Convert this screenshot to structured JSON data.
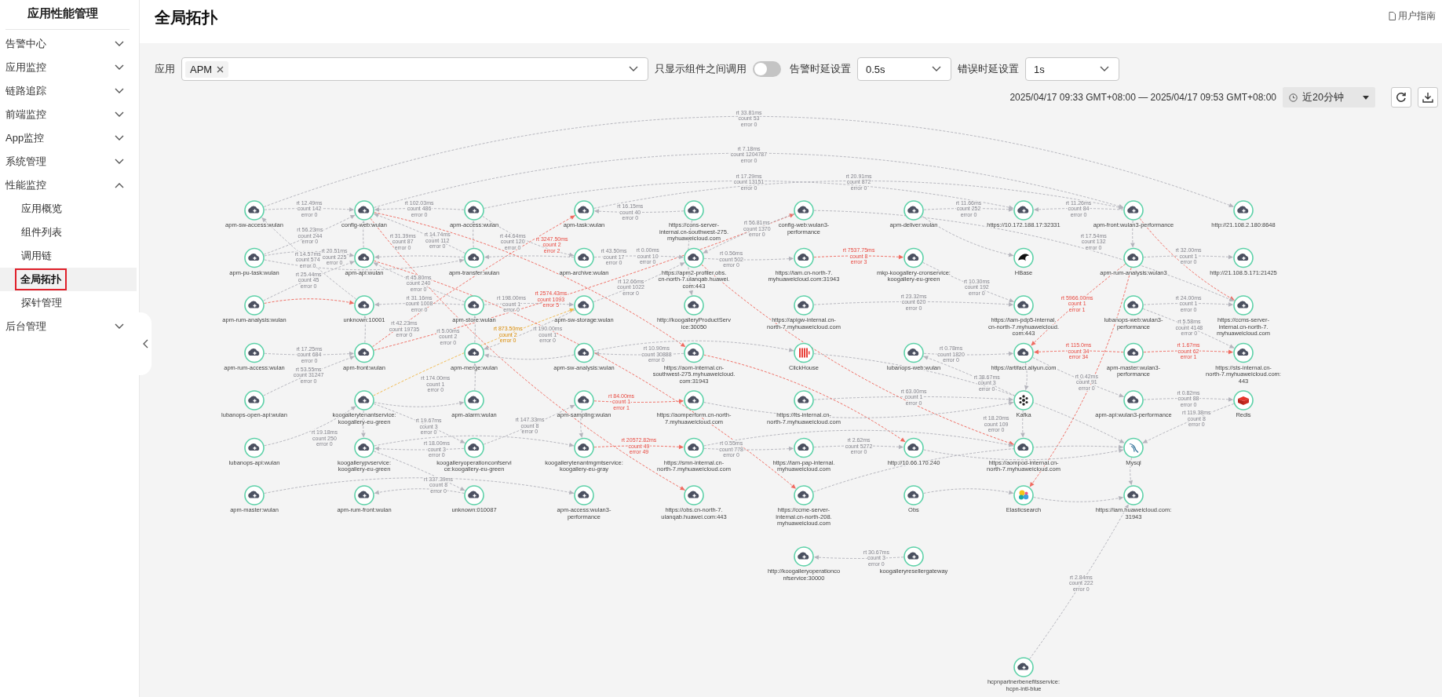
{
  "sidebar": {
    "title": "应用性能管理",
    "items": [
      {
        "label": "告警中心",
        "expanded": false
      },
      {
        "label": "应用监控",
        "expanded": false
      },
      {
        "label": "链路追踪",
        "expanded": false
      },
      {
        "label": "前端监控",
        "expanded": false
      },
      {
        "label": "App监控",
        "expanded": false
      },
      {
        "label": "系统管理",
        "expanded": false
      },
      {
        "label": "性能监控",
        "expanded": true,
        "children": [
          {
            "label": "应用概览",
            "selected": false
          },
          {
            "label": "组件列表",
            "selected": false
          },
          {
            "label": "调用链",
            "selected": false
          },
          {
            "label": "全局拓扑",
            "selected": true
          },
          {
            "label": "探针管理",
            "selected": false
          }
        ]
      },
      {
        "label": "后台管理",
        "expanded": false
      }
    ]
  },
  "header": {
    "title": "全局拓扑",
    "help_link": "用户指南"
  },
  "filters": {
    "app_label": "应用",
    "app_tags": [
      "APM"
    ],
    "toggle_label": "只显示组件之间调用",
    "toggle_on": false,
    "alarm_label": "告警时延设置",
    "alarm_value": "0.5s",
    "error_label": "错误时延设置",
    "error_value": "1s"
  },
  "time_range": {
    "text": "2025/04/17 09:33 GMT+08:00 — 2025/04/17 09:53 GMT+08:00",
    "preset": "近20分钟"
  },
  "topology": {
    "nodes": [
      {
        "label": "apm-sw-access:wulan",
        "kind": "service"
      },
      {
        "label": "config-web:wulan",
        "kind": "service"
      },
      {
        "label": "apm-access:wulan",
        "kind": "service"
      },
      {
        "label": "apm-task:wulan",
        "kind": "service"
      },
      {
        "label": "https://cons-server-internal.cn-southwest-275.myhuaweicloud.com",
        "kind": "service"
      },
      {
        "label": "config-web:wulan3-performance",
        "kind": "service"
      },
      {
        "label": "apm-deliver:wulan",
        "kind": "service"
      },
      {
        "label": "https://10.172.188.17:32331",
        "kind": "service"
      },
      {
        "label": "apm-front:wulan3-performance",
        "kind": "service"
      },
      {
        "label": "http://21.108.2.180:8648",
        "kind": "service"
      },
      {
        "label": "apm-pu-task:wulan",
        "kind": "service"
      },
      {
        "label": "apm-api:wulan",
        "kind": "service"
      },
      {
        "label": "apm-transfer:wulan",
        "kind": "service"
      },
      {
        "label": "apm-archive:wulan",
        "kind": "service"
      },
      {
        "label": "https://apm2-profiler.obs.cn-north-7.ulanqab.huawei.com:443",
        "kind": "service"
      },
      {
        "label": "https://iam.cn-north-7.myhuaweicloud.com:31943",
        "kind": "service"
      },
      {
        "label": "mkp-koogallery-cronservice:koogallery-eu-green",
        "kind": "service"
      },
      {
        "label": "HBase",
        "kind": "hbase"
      },
      {
        "label": "apm-rum-analysis:wulan3",
        "kind": "service"
      },
      {
        "label": "http://21.108.5.171:21425",
        "kind": "service"
      },
      {
        "label": "apm-rum-analysis:wulan",
        "kind": "service"
      },
      {
        "label": "unknown:10001",
        "kind": "service"
      },
      {
        "label": "apm-store:wulan",
        "kind": "service"
      },
      {
        "label": "apm-sw-storage:wulan",
        "kind": "service"
      },
      {
        "label": "http://koogalleryProductService:30050",
        "kind": "service"
      },
      {
        "label": "https://apigw-internal.cn-north-7.myhuaweicloud.com",
        "kind": "service"
      },
      {
        "label": "https://iam-pdp5-internal.cn-north-7.myhuaweicloud.com:443",
        "kind": "service"
      },
      {
        "label": "lubanops-web:wulan3-performance",
        "kind": "service"
      },
      {
        "label": "https://ccms-server-internal.cn-north-7.myhuaweicloud.com",
        "kind": "service"
      },
      {
        "label": "apm-rum-access:wulan",
        "kind": "service"
      },
      {
        "label": "apm-front:wulan",
        "kind": "service"
      },
      {
        "label": "apm-merge:wulan",
        "kind": "service"
      },
      {
        "label": "apm-sw-analysis:wulan",
        "kind": "service"
      },
      {
        "label": "https://aom-internal.cn-southwest-275.myhuaweicloud.com:31943",
        "kind": "service"
      },
      {
        "label": "ClickHouse",
        "kind": "clickhouse"
      },
      {
        "label": "lubanops-web:wulan",
        "kind": "service"
      },
      {
        "label": "https://artifact.aliyun.com",
        "kind": "service"
      },
      {
        "label": "apm-master:wulan3-performance",
        "kind": "service"
      },
      {
        "label": "https://sts-internal.cn-north-7.myhuaweicloud.com:443",
        "kind": "service"
      },
      {
        "label": "lubanops-open-api:wulan",
        "kind": "service"
      },
      {
        "label": "koogallerytenantservice:koogallery-eu-green",
        "kind": "service"
      },
      {
        "label": "apm-alarm:wulan",
        "kind": "service"
      },
      {
        "label": "apm-sampling:wulan",
        "kind": "service"
      },
      {
        "label": "https://aomperform.cn-north-7.myhuaweicloud.com",
        "kind": "service"
      },
      {
        "label": "https://lts-internal.cn-north-7.myhuaweicloud.com",
        "kind": "service"
      },
      {
        "label": "Kafka",
        "kind": "kafka"
      },
      {
        "label": "apm-api:wulan3-performance",
        "kind": "service"
      },
      {
        "label": "Redis",
        "kind": "redis"
      },
      {
        "label": "lubanops-api:wulan",
        "kind": "service"
      },
      {
        "label": "koogallerypvservice:koogallery-eu-green",
        "kind": "service"
      },
      {
        "label": "koogalleryoperationconfservice:koogallery-eu-green",
        "kind": "service"
      },
      {
        "label": "koogallerytenantmgmtservice:koogallery-eu-gray",
        "kind": "service"
      },
      {
        "label": "https://smn-internal.cn-north-7.myhuaweicloud.com",
        "kind": "service"
      },
      {
        "label": "https://iam-pap-internal.myhuaweicloud.com",
        "kind": "service"
      },
      {
        "label": "http://10.66.170.240",
        "kind": "service"
      },
      {
        "label": "https://aompod-internal.cn-north-7.myhuaweicloud.com",
        "kind": "service"
      },
      {
        "label": "Mysql",
        "kind": "mysql"
      },
      {
        "label": "apm-master:wulan",
        "kind": "service"
      },
      {
        "label": "apm-rum-front:wulan",
        "kind": "service"
      },
      {
        "label": "unknown:010087",
        "kind": "service"
      },
      {
        "label": "apm-access:wulan3-performance",
        "kind": "service"
      },
      {
        "label": "https://obs.cn-north-7.ulanqab.huawei.com:443",
        "kind": "service"
      },
      {
        "label": "https://ccme-server-internal.cn-north-208.myhuaweicloud.com",
        "kind": "service"
      },
      {
        "label": "Obs",
        "kind": "service"
      },
      {
        "label": "Elasticsearch",
        "kind": "elasticsearch"
      },
      {
        "label": "https://iam.huaweicloud.com:31943",
        "kind": "service"
      },
      {
        "label": "http://koogalleryoperationconfservice:30000",
        "kind": "service"
      },
      {
        "label": "koogalleryresellergateway",
        "kind": "service"
      },
      {
        "label": "hcpnpartnerbenefitsservice:hcpn-intl-blue",
        "kind": "service"
      }
    ],
    "edges": [
      {
        "alarm": false,
        "warning": false,
        "rt": "rt 33.81ms",
        "count": "count 53",
        "error": "error 0"
      },
      {
        "alarm": false,
        "warning": false,
        "rt": "rt 7.18ms",
        "count": "count 1204787",
        "error": "error 0"
      },
      {
        "alarm": false,
        "warning": false,
        "rt": "rt 17.29ms",
        "count": "count 13151",
        "error": "error 0"
      },
      {
        "alarm": false,
        "warning": false,
        "rt": "rt 20.91ms",
        "count": "count 872",
        "error": "error 0"
      },
      {
        "alarm": false,
        "warning": false,
        "rt": "rt 12.49ms",
        "count": "count 142",
        "error": "error 0"
      },
      {
        "alarm": false,
        "warning": false,
        "rt": "rt 56.23ms",
        "count": "count 244",
        "error": "error 0"
      },
      {
        "alarm": false,
        "warning": false,
        "rt": "rt 25.44ms",
        "count": "count 45",
        "error": "error 0"
      },
      {
        "alarm": false,
        "warning": false,
        "rt": "rt 17.25ms",
        "count": "count 684",
        "error": "error 0"
      },
      {
        "alarm": false,
        "warning": false,
        "rt": "rt 53.55ms",
        "count": "count 31247",
        "error": "error 0"
      },
      {
        "alarm": false,
        "warning": false,
        "rt": "rt 19.18ms",
        "count": "count 250",
        "error": "error 0"
      },
      {
        "alarm": false,
        "warning": false,
        "rt": "rt 337.39ms",
        "count": "count 8",
        "error": "error 0"
      },
      {
        "alarm": false,
        "warning": false,
        "rt": "rt 102.03ms",
        "count": "count 486",
        "error": "error 0"
      },
      {
        "alarm": false,
        "warning": false,
        "rt": "rt 31.39ms",
        "count": "count 87",
        "error": "error 0"
      },
      {
        "alarm": false,
        "warning": false,
        "rt": "rt 14.74ms",
        "count": "count 112",
        "error": "error 0"
      },
      {
        "alarm": false,
        "warning": false,
        "rt": "rt 44.64ms",
        "count": "count 120",
        "error": "error 0"
      },
      {
        "alarm": false,
        "warning": false,
        "rt": "rt 20.51ms",
        "count": "count 225",
        "error": "error 0"
      },
      {
        "alarm": false,
        "warning": false,
        "rt": "rt 45.80ms",
        "count": "count 240",
        "error": "error 0"
      },
      {
        "alarm": false,
        "warning": false,
        "rt": "rt 31.16ms",
        "count": "count 1008",
        "error": "error 0"
      },
      {
        "alarm": false,
        "warning": false,
        "rt": "rt 14.57ms",
        "count": "count 574",
        "error": "error 0"
      },
      {
        "alarm": false,
        "warning": false,
        "rt": "rt 42.23ms",
        "count": "count 19735",
        "error": "error 0"
      },
      {
        "alarm": true,
        "warning": false,
        "rt": "rt 3247.50ms",
        "count": "count 2",
        "error": "error 2"
      },
      {
        "alarm": true,
        "warning": false,
        "rt": "rt 2574.43ms",
        "count": "count 1093",
        "error": "error 5"
      },
      {
        "alarm": false,
        "warning": false,
        "rt": "rt 16.15ms",
        "count": "count 40",
        "error": "error 0"
      },
      {
        "alarm": false,
        "warning": false,
        "rt": "rt 56.81ms",
        "count": "count 1370",
        "error": "error 0"
      },
      {
        "alarm": false,
        "warning": true,
        "rt": "rt 873.50ms",
        "count": "count 2",
        "error": "error 0"
      },
      {
        "alarm": false,
        "warning": false,
        "rt": "rt 174.00ms",
        "count": "count 1",
        "error": "error 0"
      },
      {
        "alarm": false,
        "warning": false,
        "rt": "rt 19.67ms",
        "count": "count 3",
        "error": "error 0"
      },
      {
        "alarm": false,
        "warning": false,
        "rt": "rt 147.33ms",
        "count": "count 8",
        "error": "error 0"
      },
      {
        "alarm": false,
        "warning": false,
        "rt": "rt 18.00ms",
        "count": "count 3",
        "error": "error 0"
      },
      {
        "alarm": true,
        "warning": false,
        "rt": "rt 84.00ms",
        "count": "count 1",
        "error": "error 1"
      },
      {
        "alarm": true,
        "warning": false,
        "rt": "rt 20572.82ms",
        "count": "count 49",
        "error": "error 49"
      },
      {
        "alarm": false,
        "warning": false,
        "rt": "rt 0.55ms",
        "count": "count 778",
        "error": "error 0"
      },
      {
        "alarm": false,
        "warning": false,
        "rt": "rt 10.90ms",
        "count": "count 30888",
        "error": "error 0"
      },
      {
        "alarm": false,
        "warning": false,
        "rt": "rt 0.56ms",
        "count": "count 502",
        "error": "error 0"
      },
      {
        "alarm": false,
        "warning": false,
        "rt": "rt 198.00ms",
        "count": "count 1",
        "error": "error 0"
      },
      {
        "alarm": false,
        "warning": false,
        "rt": "rt 5.00ms",
        "count": "count 2",
        "error": "error 0"
      },
      {
        "alarm": false,
        "warning": false,
        "rt": "rt 190.00ms",
        "count": "count 1",
        "error": "error 0"
      },
      {
        "alarm": false,
        "warning": false,
        "rt": "rt 43.50ms",
        "count": "count 17",
        "error": "error 0"
      },
      {
        "alarm": false,
        "warning": false,
        "rt": "rt 0.00ms",
        "count": "count 10",
        "error": "error 0"
      },
      {
        "alarm": false,
        "warning": false,
        "rt": "rt 12.66ms",
        "count": "count 1022",
        "error": "error 0"
      },
      {
        "alarm": false,
        "warning": false,
        "rt": "rt 11.66ms",
        "count": "count 252",
        "error": "error 0"
      },
      {
        "alarm": false,
        "warning": false,
        "rt": "rt 11.26ms",
        "count": "count 84",
        "error": "error 0"
      },
      {
        "alarm": true,
        "warning": false,
        "rt": "rt 7537.75ms",
        "count": "count 8",
        "error": "error 3"
      },
      {
        "alarm": false,
        "warning": false,
        "rt": "rt 17.54ms",
        "count": "count 132",
        "error": "error 0"
      },
      {
        "alarm": false,
        "warning": false,
        "rt": "rt 32.00ms",
        "count": "count 1",
        "error": "error 0"
      },
      {
        "alarm": false,
        "warning": false,
        "rt": "rt 10.30ms",
        "count": "count 192",
        "error": "error 0"
      },
      {
        "alarm": false,
        "warning": false,
        "rt": "rt 23.32ms",
        "count": "count 620",
        "error": "error 0"
      },
      {
        "alarm": true,
        "warning": false,
        "rt": "rt 5966.00ms",
        "count": "count 1",
        "error": "error 1"
      },
      {
        "alarm": false,
        "warning": false,
        "rt": "rt 24.00ms",
        "count": "count 1",
        "error": "error 0"
      },
      {
        "alarm": false,
        "warning": false,
        "rt": "rt 0.78ms",
        "count": "count 1820",
        "error": "error 0"
      },
      {
        "alarm": false,
        "warning": false,
        "rt": "rt 5.58ms",
        "count": "count 4148",
        "error": "error 0"
      },
      {
        "alarm": true,
        "warning": false,
        "rt": "rt 115.0ms",
        "count": "count 34",
        "error": "error 34"
      },
      {
        "alarm": true,
        "warning": false,
        "rt": "rt 1.67ms",
        "count": "count 62",
        "error": "error 1"
      },
      {
        "alarm": false,
        "warning": false,
        "rt": "rt 0.42ms",
        "count": "count 91",
        "error": "error 0"
      },
      {
        "alarm": false,
        "warning": false,
        "rt": "rt 0.82ms",
        "count": "count 88",
        "error": "error 0"
      },
      {
        "alarm": false,
        "warning": false,
        "rt": "rt 38.67ms",
        "count": "count 3",
        "error": "error 0"
      },
      {
        "alarm": false,
        "warning": false,
        "rt": "rt 63.00ms",
        "count": "count 1",
        "error": "error 0"
      },
      {
        "alarm": false,
        "warning": false,
        "rt": "rt 18.20ms",
        "count": "count 109",
        "error": "error 0"
      },
      {
        "alarm": false,
        "warning": false,
        "rt": "rt 2.62ms",
        "count": "count 5272",
        "error": "error 0"
      },
      {
        "alarm": false,
        "warning": false,
        "rt": "rt 119.38ms",
        "count": "count 8",
        "error": "error 0"
      },
      {
        "alarm": false,
        "warning": false,
        "rt": "rt 30.67ms",
        "count": "count 3",
        "error": "error 0"
      },
      {
        "alarm": false,
        "warning": false,
        "rt": "rt 2.84ms",
        "count": "count 222",
        "error": "error 0"
      }
    ]
  }
}
